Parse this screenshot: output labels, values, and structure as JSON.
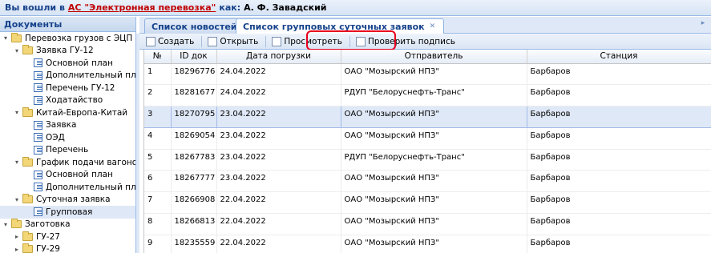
{
  "header": {
    "prefix": "Вы вошли в",
    "system_link": "АС \"Электронная перевозка\"",
    "as_label": "как:",
    "user": "А. Ф. Завадский"
  },
  "sidebar": {
    "title": "Документы",
    "items": [
      {
        "label": "Перевозка грузов с ЭЦП",
        "level": 0,
        "type": "folder",
        "expanded": true
      },
      {
        "label": "Заявка ГУ-12",
        "level": 1,
        "type": "folder",
        "expanded": true
      },
      {
        "label": "Основной план",
        "level": 2,
        "type": "doc"
      },
      {
        "label": "Дополнительный план",
        "level": 2,
        "type": "doc"
      },
      {
        "label": "Перечень ГУ-12",
        "level": 2,
        "type": "doc"
      },
      {
        "label": "Ходатайство",
        "level": 2,
        "type": "doc"
      },
      {
        "label": "Китай-Европа-Китай",
        "level": 1,
        "type": "folder",
        "expanded": true
      },
      {
        "label": "Заявка",
        "level": 2,
        "type": "doc"
      },
      {
        "label": "ОЭД",
        "level": 2,
        "type": "doc"
      },
      {
        "label": "Перечень",
        "level": 2,
        "type": "doc"
      },
      {
        "label": "График подачи вагонов ГУ-11",
        "level": 1,
        "type": "folder",
        "expanded": true
      },
      {
        "label": "Основной план",
        "level": 2,
        "type": "doc"
      },
      {
        "label": "Дополнительный план",
        "level": 2,
        "type": "doc"
      },
      {
        "label": "Суточная заявка",
        "level": 1,
        "type": "folder",
        "expanded": true
      },
      {
        "label": "Групповая",
        "level": 2,
        "type": "doc",
        "selected": true
      },
      {
        "label": "Заготовка",
        "level": 0,
        "type": "folder",
        "expanded": true
      },
      {
        "label": "ГУ-27",
        "level": 1,
        "type": "folder",
        "expanded": false
      },
      {
        "label": "ГУ-29",
        "level": 1,
        "type": "folder",
        "expanded": false
      }
    ]
  },
  "tabs": [
    {
      "label": "Список новостей",
      "active": false
    },
    {
      "label": "Список групповых суточных заявок",
      "active": true
    }
  ],
  "toolbar": {
    "create": "Создать",
    "open": "Открыть",
    "view": "Просмотреть",
    "verify": "Проверить подпись"
  },
  "grid": {
    "columns": [
      "№",
      "ID док",
      "Дата погрузки",
      "Отправитель",
      "Станция"
    ],
    "rows": [
      [
        "1",
        "18296776",
        "24.04.2022",
        "ОАО \"Мозырский НПЗ\"",
        "Барбаров"
      ],
      [
        "2",
        "18281677",
        "24.04.2022",
        "РДУП \"Белоруснефть-Транс\"",
        "Барбаров"
      ],
      [
        "3",
        "18270795",
        "23.04.2022",
        "ОАО \"Мозырский НПЗ\"",
        "Барбаров"
      ],
      [
        "4",
        "18269054",
        "23.04.2022",
        "ОАО \"Мозырский НПЗ\"",
        "Барбаров"
      ],
      [
        "5",
        "18267783",
        "23.04.2022",
        "РДУП \"Белоруснефть-Транс\"",
        "Барбаров"
      ],
      [
        "6",
        "18267777",
        "23.04.2022",
        "ОАО \"Мозырский НПЗ\"",
        "Барбаров"
      ],
      [
        "7",
        "18266908",
        "22.04.2022",
        "ОАО \"Мозырский НПЗ\"",
        "Барбаров"
      ],
      [
        "8",
        "18266813",
        "22.04.2022",
        "ОАО \"Мозырский НПЗ\"",
        "Барбаров"
      ],
      [
        "9",
        "18235559",
        "22.04.2022",
        "ОАО \"Мозырский НПЗ\"",
        "Барбаров"
      ]
    ],
    "selected_row": 3
  },
  "colors": {
    "highlight": "#e8001c",
    "header_text": "#15428b",
    "link": "#c00000"
  }
}
